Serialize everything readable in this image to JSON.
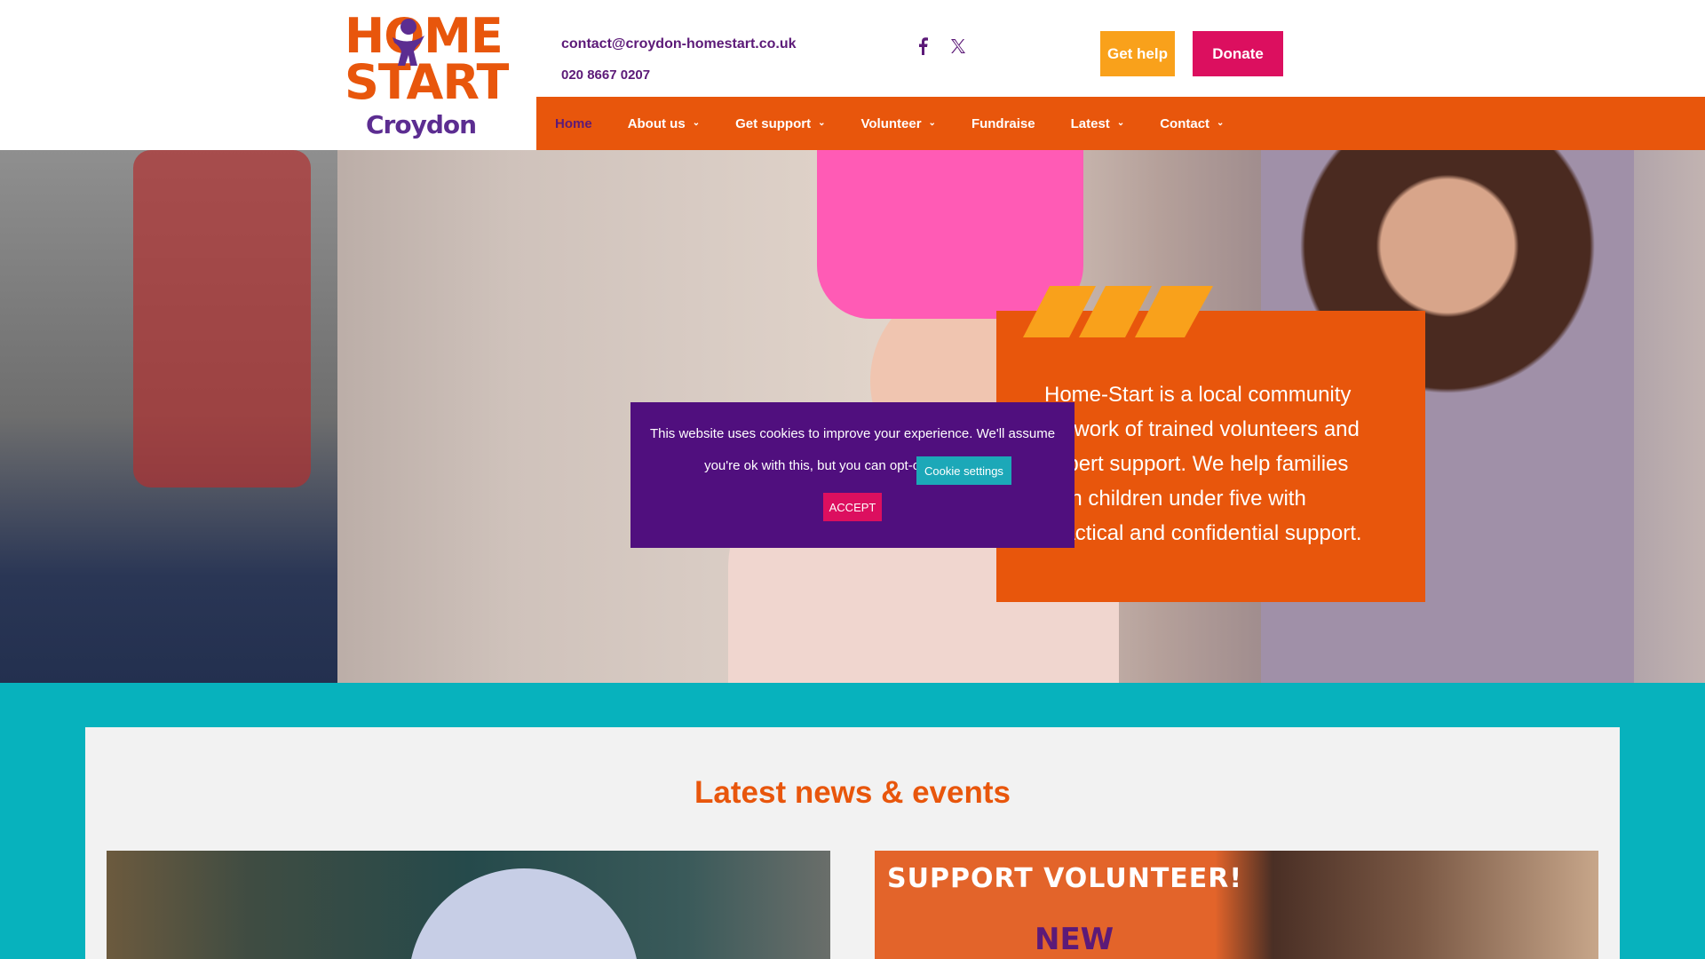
{
  "brand": {
    "logo_line1": "HOME",
    "logo_line2": "START",
    "logo_city": "Croydon",
    "colors": {
      "orange": "#e8560c",
      "purple": "#5c1a78",
      "teal": "#07b2bd",
      "pink": "#dc0f5f",
      "yellow": "#f9a11b"
    }
  },
  "header": {
    "email": "contact@croydon-homestart.co.uk",
    "phone": "020 8667 0207",
    "social": [
      {
        "name": "facebook-icon",
        "glyph": "f"
      },
      {
        "name": "x-twitter-icon",
        "glyph": "𝕏"
      }
    ],
    "get_help_label": "Get help",
    "donate_label": "Donate"
  },
  "nav": {
    "items": [
      {
        "label": "Home",
        "active": true,
        "has_dropdown": false
      },
      {
        "label": "About us",
        "active": false,
        "has_dropdown": true
      },
      {
        "label": "Get support",
        "active": false,
        "has_dropdown": true
      },
      {
        "label": "Volunteer",
        "active": false,
        "has_dropdown": true
      },
      {
        "label": "Fundraise",
        "active": false,
        "has_dropdown": false
      },
      {
        "label": "Latest",
        "active": false,
        "has_dropdown": true
      },
      {
        "label": "Contact",
        "active": false,
        "has_dropdown": true
      }
    ]
  },
  "hero": {
    "intro_text": "Home-Start is a local community network of trained volunteers and expert support. We help families with children under five with practical and confidential support."
  },
  "cookie": {
    "message": "This website uses cookies to improve your experience. We'll assume you're ok with this, but you can opt-out if you wish.",
    "settings_label": "Cookie settings",
    "accept_label": "ACCEPT"
  },
  "news": {
    "title": "Latest news & events",
    "cards": [
      {
        "headline": ""
      },
      {
        "headline": "SUPPORT VOLUNTEER!",
        "badge": "NEW"
      }
    ]
  }
}
